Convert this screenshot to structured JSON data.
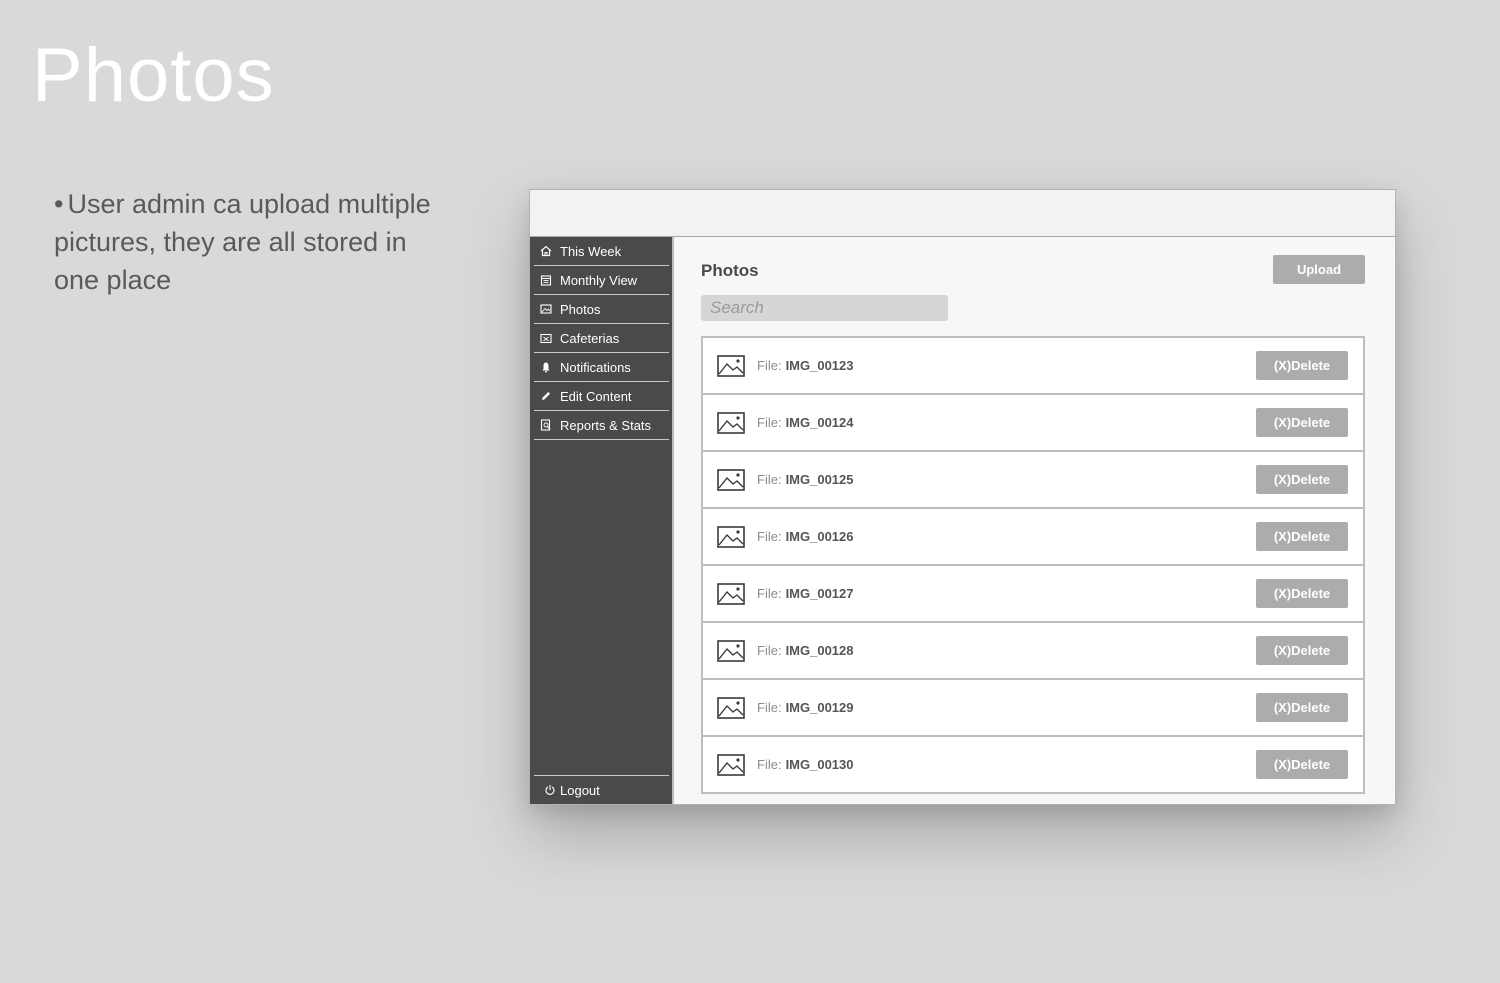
{
  "slide": {
    "title": "Photos",
    "bullet_marker": "•",
    "bullet_text": "User admin ca upload multiple pictures, they are all stored in one place"
  },
  "sidebar": {
    "items": [
      {
        "label": "This Week",
        "icon": "home-icon"
      },
      {
        "label": "Monthly View",
        "icon": "calendar-icon"
      },
      {
        "label": "Photos",
        "icon": "image-icon"
      },
      {
        "label": "Cafeterias",
        "icon": "cafeteria-icon"
      },
      {
        "label": "Notifications",
        "icon": "bell-icon"
      },
      {
        "label": "Edit Content",
        "icon": "pencil-icon"
      },
      {
        "label": "Reports & Stats",
        "icon": "report-icon"
      }
    ],
    "logout": {
      "label": "Logout",
      "icon": "power-icon"
    }
  },
  "main": {
    "heading": "Photos",
    "upload_label": "Upload",
    "search_placeholder": "Search",
    "file_prefix": "File:",
    "delete_label": "(X)Delete",
    "files": [
      {
        "name": "IMG_00123"
      },
      {
        "name": "IMG_00124"
      },
      {
        "name": "IMG_00125"
      },
      {
        "name": "IMG_00126"
      },
      {
        "name": "IMG_00127"
      },
      {
        "name": "IMG_00128"
      },
      {
        "name": "IMG_00129"
      },
      {
        "name": "IMG_00130"
      }
    ]
  },
  "colors": {
    "background": "#d9d9d9",
    "sidebar": "#4a4a4a",
    "button": "#acacac",
    "title": "#ffffff"
  }
}
